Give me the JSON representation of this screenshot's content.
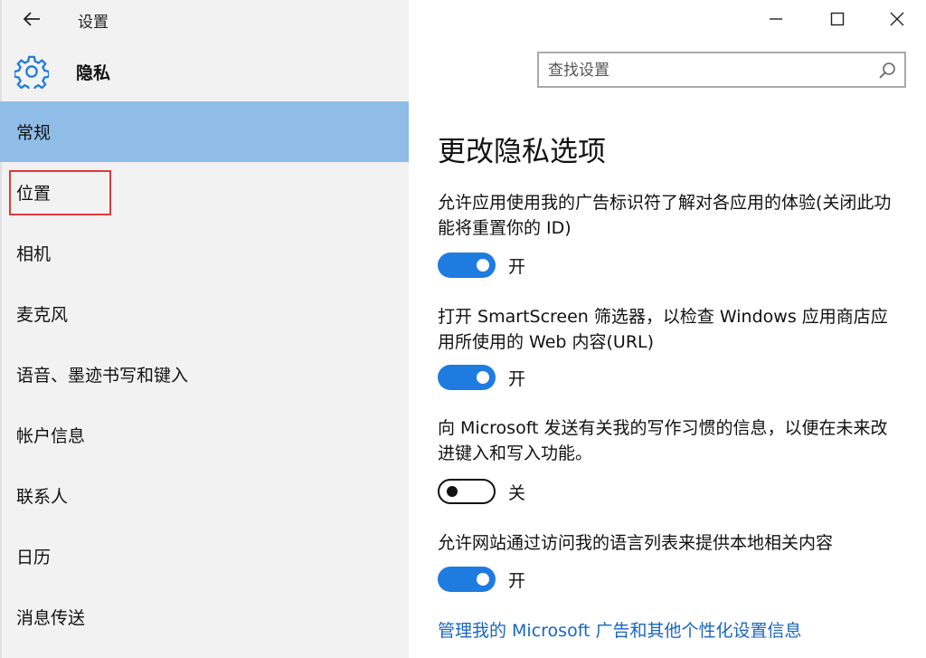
{
  "window": {
    "title": "设置"
  },
  "header": {
    "title": "隐私",
    "search_placeholder": "查找设置"
  },
  "sidebar": {
    "items": [
      {
        "label": "常规"
      },
      {
        "label": "位置"
      },
      {
        "label": "相机"
      },
      {
        "label": "麦克风"
      },
      {
        "label": "语音、墨迹书写和键入"
      },
      {
        "label": "帐户信息"
      },
      {
        "label": "联系人"
      },
      {
        "label": "日历"
      },
      {
        "label": "消息传送"
      }
    ]
  },
  "main": {
    "title": "更改隐私选项",
    "settings": [
      {
        "text": "允许应用使用我的广告标识符了解对各应用的体验(关闭此功能将重置你的 ID)",
        "state": "开"
      },
      {
        "text": "打开 SmartScreen 筛选器，以检查 Windows 应用商店应用所使用的 Web 内容(URL)",
        "state": "开"
      },
      {
        "text": "向 Microsoft 发送有关我的写作习惯的信息，以便在未来改进键入和写入功能。",
        "state": "关"
      },
      {
        "text": "允许网站通过访问我的语言列表来提供本地相关内容",
        "state": "开"
      }
    ],
    "link": "管理我的 Microsoft 广告和其他个性化设置信息"
  },
  "colors": {
    "accent": "#1e7be0",
    "selected_nav": "#90bde8",
    "link": "#1766c2",
    "highlight_box": "#e03a3a"
  }
}
